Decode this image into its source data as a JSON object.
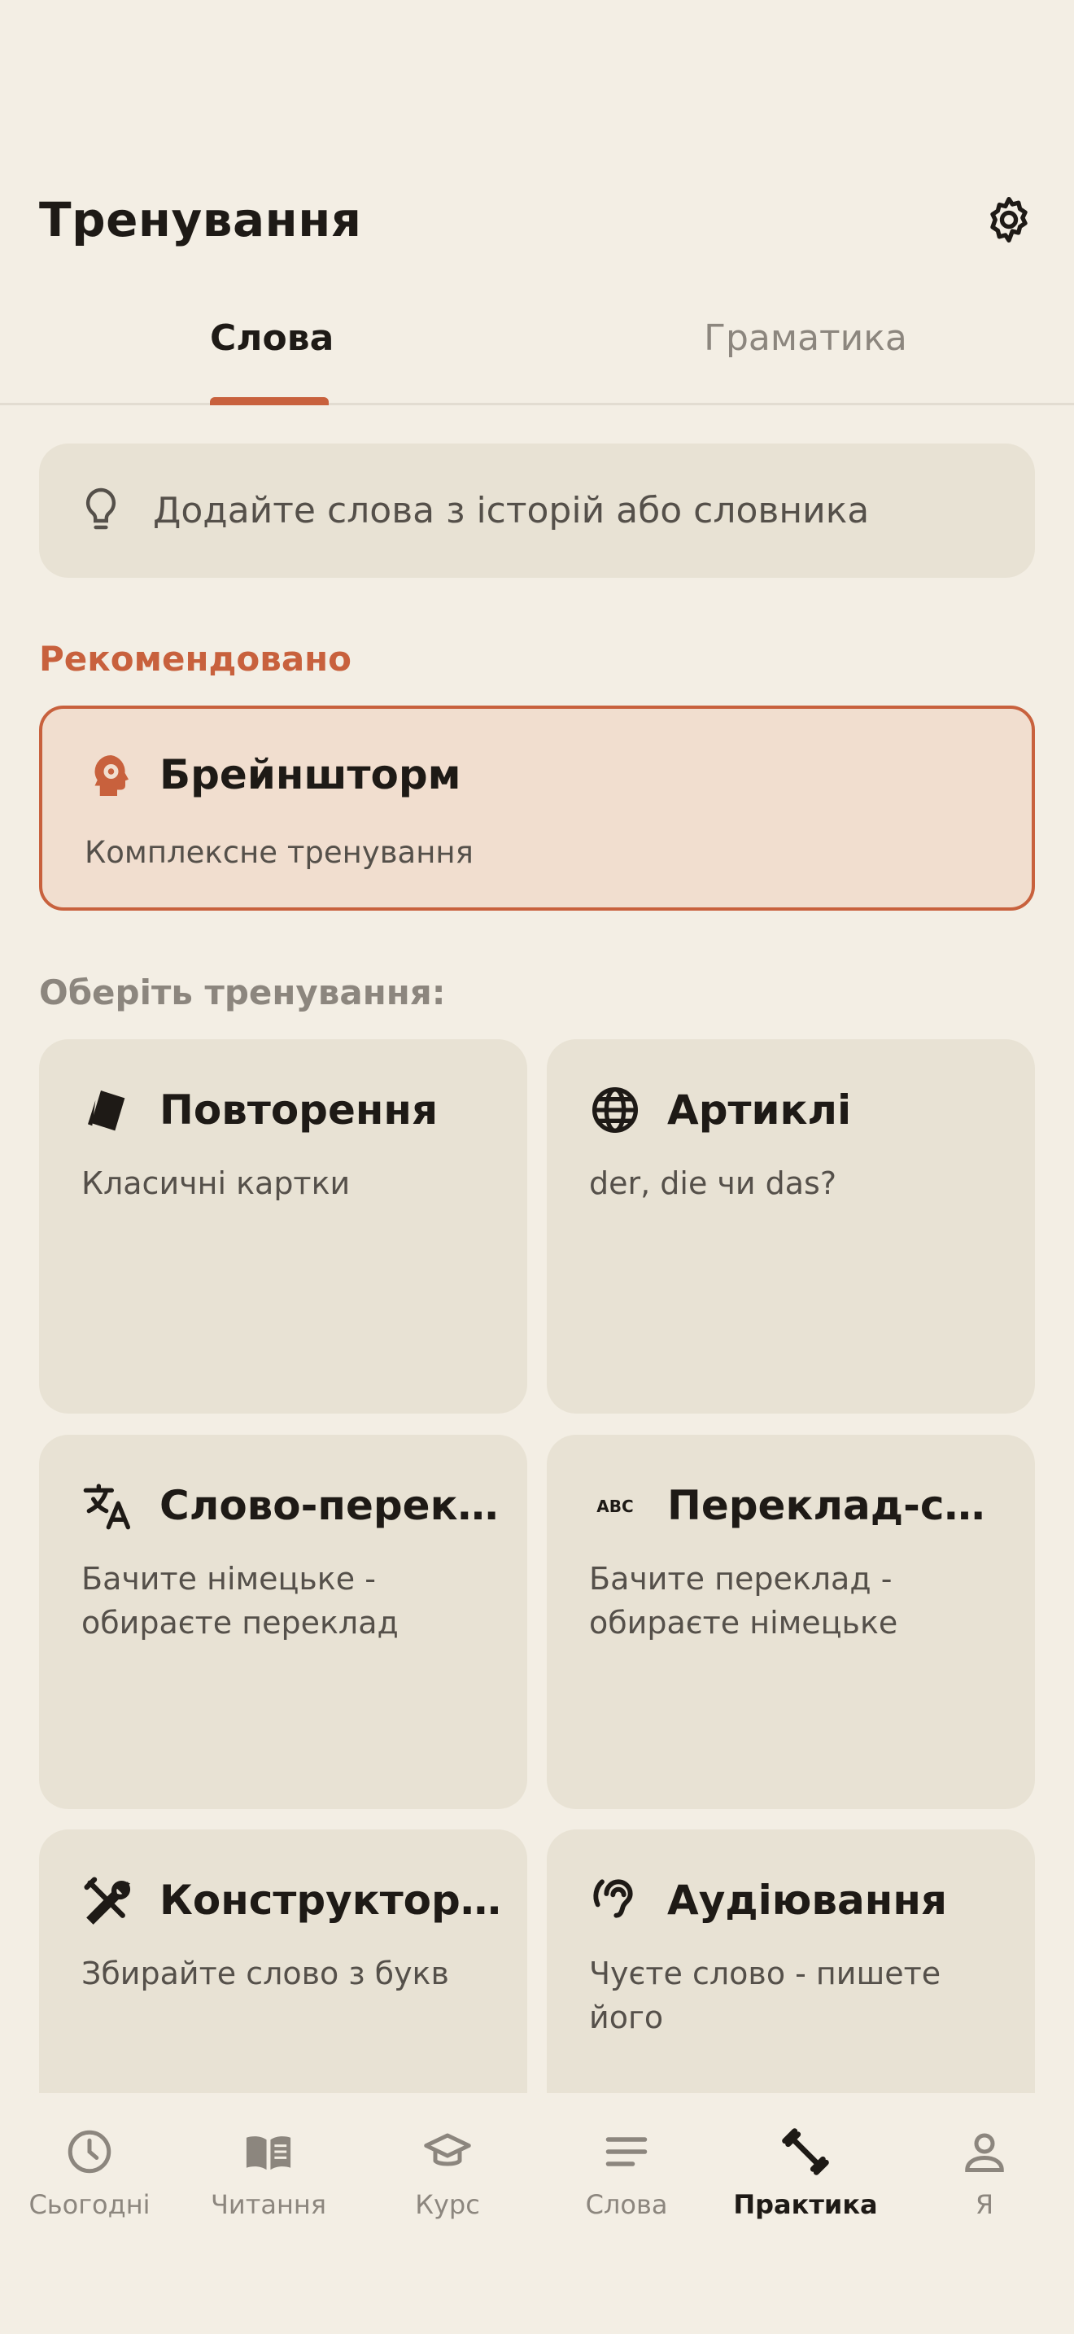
{
  "header": {
    "title": "Тренування",
    "settings_icon": "gear-icon"
  },
  "tabs": [
    {
      "label": "Слова",
      "active": true
    },
    {
      "label": "Граматика",
      "active": false
    }
  ],
  "hint": {
    "icon": "lightbulb-icon",
    "text": "Додайте слова з історій або словника"
  },
  "recommended": {
    "section_label": "Рекомендовано",
    "card": {
      "icon": "brain-gear-icon",
      "title": "Брейншторм",
      "subtitle": "Комплексне тренування"
    }
  },
  "choose": {
    "section_label": "Оберіть тренування:",
    "cards": [
      {
        "icon": "flashcards-icon",
        "title": "Повторення",
        "subtitle": "Класичні картки"
      },
      {
        "icon": "globe-icon",
        "title": "Артиклі",
        "subtitle": "der, die чи das?"
      },
      {
        "icon": "translate-icon",
        "title": "Слово-перек...",
        "subtitle": "Бачите німецьке - обираєте переклад"
      },
      {
        "icon": "abc-icon",
        "title": "Переклад-сл...",
        "subtitle": "Бачите переклад - обираєте німецьке"
      },
      {
        "icon": "tools-icon",
        "title": "Конструктор ...",
        "subtitle": "Збирайте слово з букв"
      },
      {
        "icon": "hearing-icon",
        "title": "Аудіювання",
        "subtitle": "Чуєте слово - пишете його"
      }
    ]
  },
  "nav": [
    {
      "icon": "clock-icon",
      "label": "Сьогодні",
      "active": false
    },
    {
      "icon": "book-icon",
      "label": "Читання",
      "active": false
    },
    {
      "icon": "graduation-cap-icon",
      "label": "Курс",
      "active": false
    },
    {
      "icon": "lines-icon",
      "label": "Слова",
      "active": false
    },
    {
      "icon": "dumbbell-icon",
      "label": "Практика",
      "active": true
    },
    {
      "icon": "person-icon",
      "label": "Я",
      "active": false
    }
  ],
  "colors": {
    "accent": "#C8613D",
    "background": "#F3EEE4",
    "card": "#E8E2D4",
    "recommended_bg": "#F1DECF",
    "muted": "#8C867E"
  }
}
